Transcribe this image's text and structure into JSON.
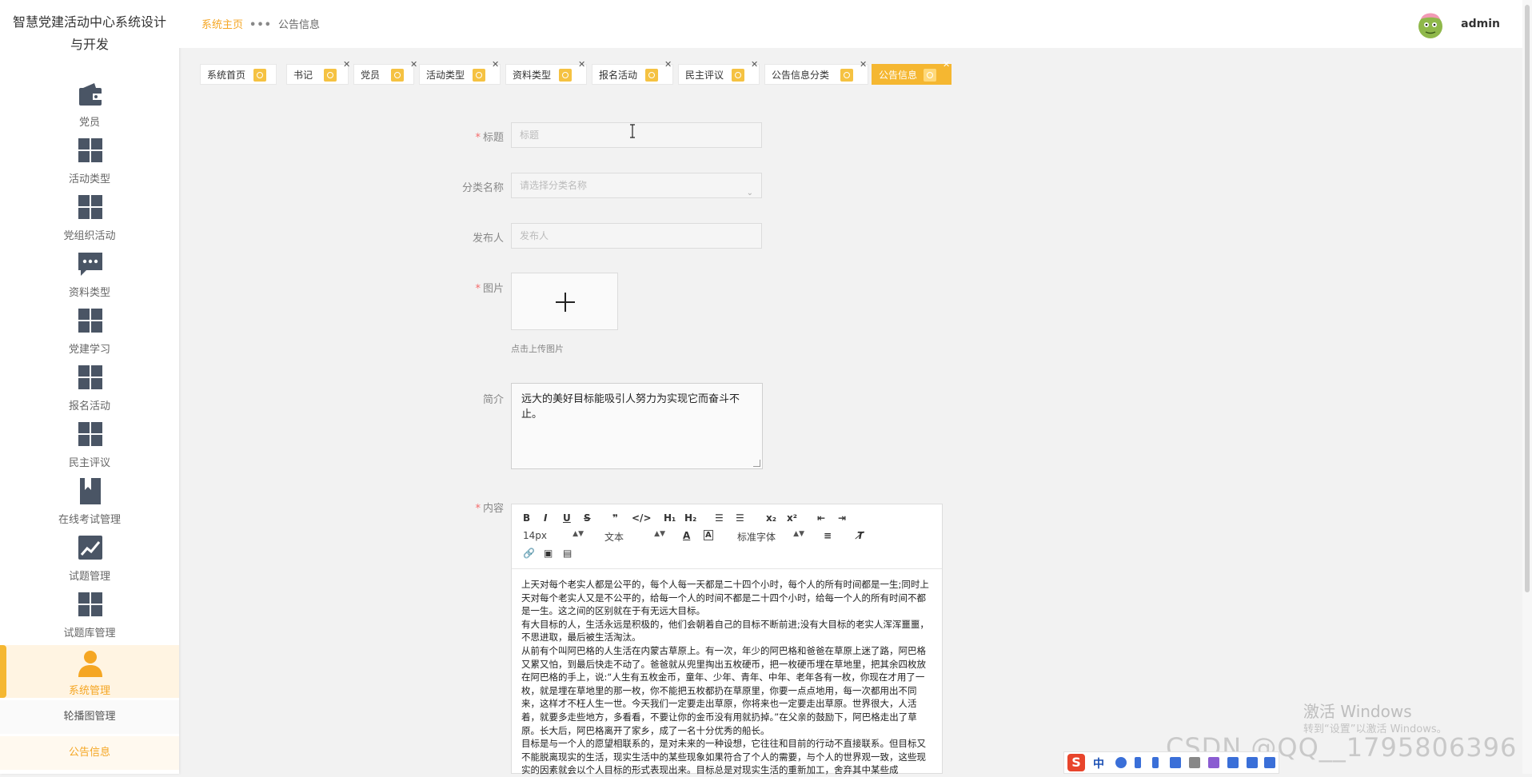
{
  "sidebar": {
    "title": "智慧党建活动中心系统设计与开发",
    "items": [
      {
        "label": "党员",
        "icon": "wallet-icon"
      },
      {
        "label": "活动类型",
        "icon": "grid-icon"
      },
      {
        "label": "党组织活动",
        "icon": "grid-icon"
      },
      {
        "label": "资料类型",
        "icon": "chat-icon"
      },
      {
        "label": "党建学习",
        "icon": "grid-icon"
      },
      {
        "label": "报名活动",
        "icon": "grid-icon"
      },
      {
        "label": "民主评议",
        "icon": "grid-icon"
      },
      {
        "label": "在线考试管理",
        "icon": "bookmark-icon"
      },
      {
        "label": "试题管理",
        "icon": "chart-icon"
      },
      {
        "label": "试题库管理",
        "icon": "grid-icon"
      },
      {
        "label": "系统管理",
        "icon": "user-icon"
      }
    ],
    "sub_items": [
      "轮播图管理",
      "公告信息"
    ],
    "accent": "#f5a623"
  },
  "header": {
    "breadcrumb_home": "系统主页",
    "breadcrumb_sep": "•••",
    "breadcrumb_current": "公告信息",
    "username": "admin"
  },
  "tabs": [
    {
      "label": "系统首页",
      "closable": false
    },
    {
      "label": "书记",
      "closable": true
    },
    {
      "label": "党员",
      "closable": true
    },
    {
      "label": "活动类型",
      "closable": true
    },
    {
      "label": "资料类型",
      "closable": true
    },
    {
      "label": "报名活动",
      "closable": true
    },
    {
      "label": "民主评议",
      "closable": true
    },
    {
      "label": "公告信息分类",
      "closable": true
    },
    {
      "label": "公告信息",
      "closable": true,
      "active": true
    }
  ],
  "form": {
    "title": {
      "label": "标题",
      "placeholder": "标题"
    },
    "category": {
      "label": "分类名称",
      "placeholder": "请选择分类名称"
    },
    "publisher": {
      "label": "发布人",
      "placeholder": "发布人"
    },
    "image": {
      "label": "图片",
      "tip": "点击上传图片"
    },
    "summary": {
      "label": "简介",
      "value": "远大的美好目标能吸引人努力为实现它而奋斗不止。"
    },
    "content": {
      "label": "内容"
    }
  },
  "editor": {
    "font_size": "14px",
    "text_type": "文本",
    "font_family": "标准字体",
    "paragraphs": [
      "上天对每个老实人都是公平的，每个人每一天都是二十四个小时，每个人的所有时间都是一生;同时上天对每个老实人又是不公平的，给每一个人的时间不都是二十四个小时，给每一个人的所有时间不都是一生。这之间的区别就在于有无远大目标。",
      "有大目标的人，生活永远是积极的，他们会朝着自己的目标不断前进;没有大目标的老实人浑浑噩噩，不思进取，最后被生活淘汰。",
      "从前有个叫阿巴格的人生活在内蒙古草原上。有一次，年少的阿巴格和爸爸在草原上迷了路，阿巴格又累又怕，到最后快走不动了。爸爸就从兜里掏出五枚硬币，把一枚硬币埋在草地里，把其余四枚放在阿巴格的手上，说:“人生有五枚金币，童年、少年、青年、中年、老年各有一枚，你现在才用了一枚，就是埋在草地里的那一枚，你不能把五枚都扔在草原里，你要一点点地用，每一次都用出不同来，这样才不枉人生一世。今天我们一定要走出草原，你将来也一定要走出草原。世界很大，人活着，就要多走些地方，多看看，不要让你的金币没有用就扔掉。”在父亲的鼓励下，阿巴格走出了草原。长大后，阿巴格离开了家乡，成了一名十分优秀的船长。",
      "目标是与一个人的愿望相联系的，是对未来的一种设想，它往往和目前的行动不直接联系。但目标又不能脱离现实的生活，现实生活中的某些现象如果符合了个人的需要，与个人的世界观一致，这些现实的因素就会以个人目标的形式表现出来。目标总是对现实生活的重新加工，舍弃其中某些成"
    ]
  },
  "overlay": {
    "activate_title": "激活 Windows",
    "activate_sub": "转到“设置”以激活 Windows。",
    "csdn_watermark": "CSDN @QQ__1795806396",
    "ime_s": "S",
    "ime_lang": "中"
  }
}
